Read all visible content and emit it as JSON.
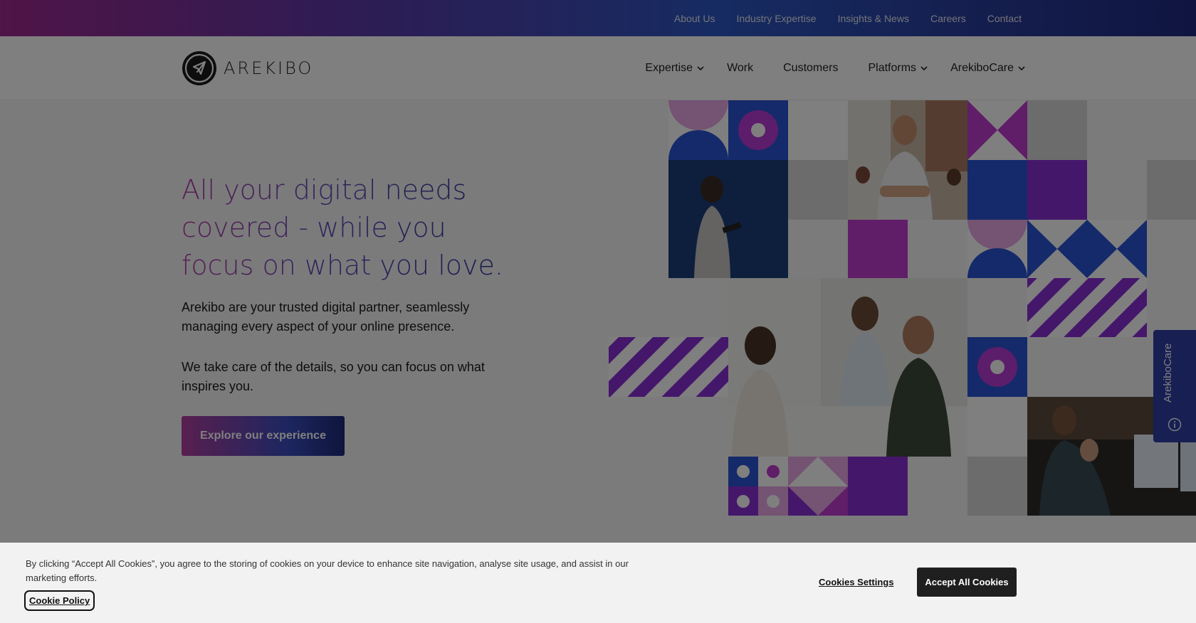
{
  "topbar": {
    "links": [
      "About Us",
      "Industry Expertise",
      "Insights & News",
      "Careers",
      "Contact"
    ]
  },
  "header": {
    "logo_text": "AREKIBO",
    "nav": [
      {
        "label": "Expertise",
        "dropdown": true
      },
      {
        "label": "Work",
        "dropdown": false
      },
      {
        "label": "Customers",
        "dropdown": false
      },
      {
        "label": "Platforms",
        "dropdown": true
      },
      {
        "label": "ArekiboCare",
        "dropdown": true
      }
    ]
  },
  "hero": {
    "headline": "All your digital needs covered - while you focus on what you love.",
    "paragraph1": "Arekibo are your trusted digital partner, seamlessly managing every aspect of your online presence.",
    "paragraph2": "We take care of the details, so you can focus on what inspires you.",
    "cta_label": "Explore our experience"
  },
  "side_tab": {
    "label": "ArekiboCare",
    "icon": "info-icon"
  },
  "cookie_banner": {
    "text": "By clicking “Accept All Cookies”, you agree to the storing of cookies on your device to enhance site navigation, analyse site usage, and assist in our marketing efforts.",
    "policy_link": "Cookie Policy",
    "settings_label": "Cookies Settings",
    "accept_label": "Accept All Cookies"
  },
  "colors": {
    "purple": "#8a2fd6",
    "magenta": "#c13ad1",
    "blue": "#2a55d4",
    "light_pink": "#e9a6e6",
    "light_grey": "#d9d9d9",
    "overlay": "rgba(0,0,0,0.5)"
  }
}
